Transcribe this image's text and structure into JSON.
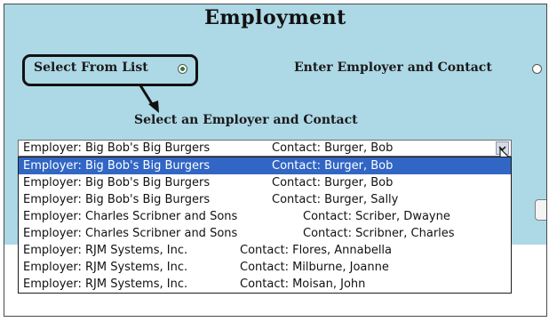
{
  "page": {
    "title": "Employment",
    "select_from_list_label": "Select From List",
    "enter_employer_label": "Enter Employer and Contact",
    "subheading": "Select an Employer and Contact"
  },
  "dropdown": {
    "selected": {
      "employer": "Employer: Big Bob's Big Burgers",
      "contact": "Contact: Burger, Bob"
    },
    "options": [
      {
        "employer": "Employer: Big Bob's Big Burgers",
        "contact": "Contact: Burger, Bob",
        "highlighted": true
      },
      {
        "employer": "Employer: Big Bob's Big Burgers",
        "contact": "Contact: Burger, Bob"
      },
      {
        "employer": "Employer: Big Bob's Big Burgers",
        "contact": "Contact: Burger, Sally"
      },
      {
        "employer": "Employer: Charles Scribner and Sons",
        "contact": "Contact: Scriber, Dwayne"
      },
      {
        "employer": "Employer: Charles Scribner and Sons",
        "contact": "Contact: Scribner, Charles"
      },
      {
        "employer": "Employer: RJM Systems, Inc.",
        "contact": "Contact: Flores, Annabella"
      },
      {
        "employer": "Employer: RJM Systems, Inc.",
        "contact": "Contact: Milburne, Joanne"
      },
      {
        "employer": "Employer: RJM Systems, Inc.",
        "contact": "Contact: Moisan, John"
      }
    ]
  },
  "icons": {
    "radio_selected": "radio-selected-icon",
    "radio_unselected": "radio-unselected-icon",
    "dropdown_arrow": "chevron-down-icon",
    "cursor": "mouse-pointer-icon",
    "callout_arrow": "arrow-down-icon"
  },
  "colors": {
    "panel_background": "#add8e6",
    "selection_highlight": "#3166c4",
    "radio_dot": "#2e7d32"
  }
}
